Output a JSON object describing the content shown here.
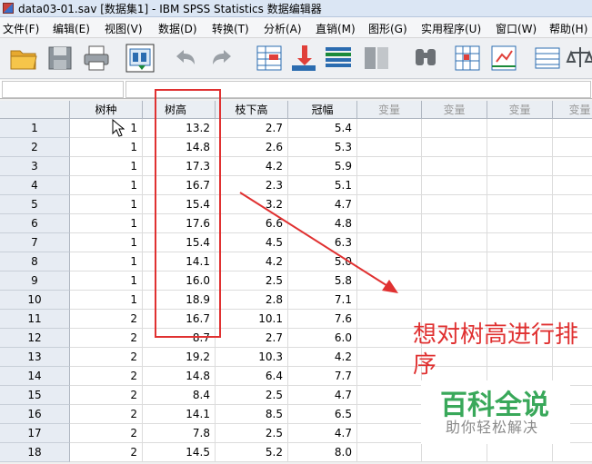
{
  "window": {
    "title": "data03-01.sav [数据集1] - IBM SPSS Statistics 数据编辑器"
  },
  "menu": [
    "文件(F)",
    "编辑(E)",
    "视图(V)",
    "数据(D)",
    "转换(T)",
    "分析(A)",
    "直销(M)",
    "图形(G)",
    "实用程序(U)",
    "窗口(W)",
    "帮助(H)"
  ],
  "toolbar": [
    "open-folder-icon",
    "save-icon",
    "print-icon",
    "dialog-recall-icon",
    "undo-icon",
    "redo-icon",
    "go-to-case-icon",
    "insert-variable-icon",
    "insert-cases-icon",
    "split-file-icon",
    "find-icon",
    "variables-icon",
    "value-labels-icon",
    "use-sets-icon",
    "weight-icon"
  ],
  "columns": [
    "树种",
    "树高",
    "枝下高",
    "冠幅",
    "变量",
    "变量",
    "变量",
    "变量"
  ],
  "rows": [
    [
      "1",
      "1",
      "13.2",
      "2.7",
      "5.4"
    ],
    [
      "2",
      "1",
      "14.8",
      "2.6",
      "5.3"
    ],
    [
      "3",
      "1",
      "17.3",
      "4.2",
      "5.9"
    ],
    [
      "4",
      "1",
      "16.7",
      "2.3",
      "5.1"
    ],
    [
      "5",
      "1",
      "15.4",
      "3.2",
      "4.7"
    ],
    [
      "6",
      "1",
      "17.6",
      "6.6",
      "4.8"
    ],
    [
      "7",
      "1",
      "15.4",
      "4.5",
      "6.3"
    ],
    [
      "8",
      "1",
      "14.1",
      "4.2",
      "5.0"
    ],
    [
      "9",
      "1",
      "16.0",
      "2.5",
      "5.8"
    ],
    [
      "10",
      "1",
      "18.9",
      "2.8",
      "7.1"
    ],
    [
      "11",
      "2",
      "16.7",
      "10.1",
      "7.6"
    ],
    [
      "12",
      "2",
      "8.7",
      "2.7",
      "6.0"
    ],
    [
      "13",
      "2",
      "19.2",
      "10.3",
      "4.2"
    ],
    [
      "14",
      "2",
      "14.8",
      "6.4",
      "7.7"
    ],
    [
      "15",
      "2",
      "8.4",
      "2.5",
      "4.7"
    ],
    [
      "16",
      "2",
      "14.1",
      "8.5",
      "6.5"
    ],
    [
      "17",
      "2",
      "7.8",
      "2.5",
      "4.7"
    ],
    [
      "18",
      "2",
      "14.5",
      "5.2",
      "8.0"
    ]
  ],
  "annotation": {
    "note": "想对树高进行排序",
    "color": "#e03131"
  },
  "watermark": {
    "title": "百科全说",
    "subtitle": "助你轻松解决",
    "color": "#39a85a"
  }
}
